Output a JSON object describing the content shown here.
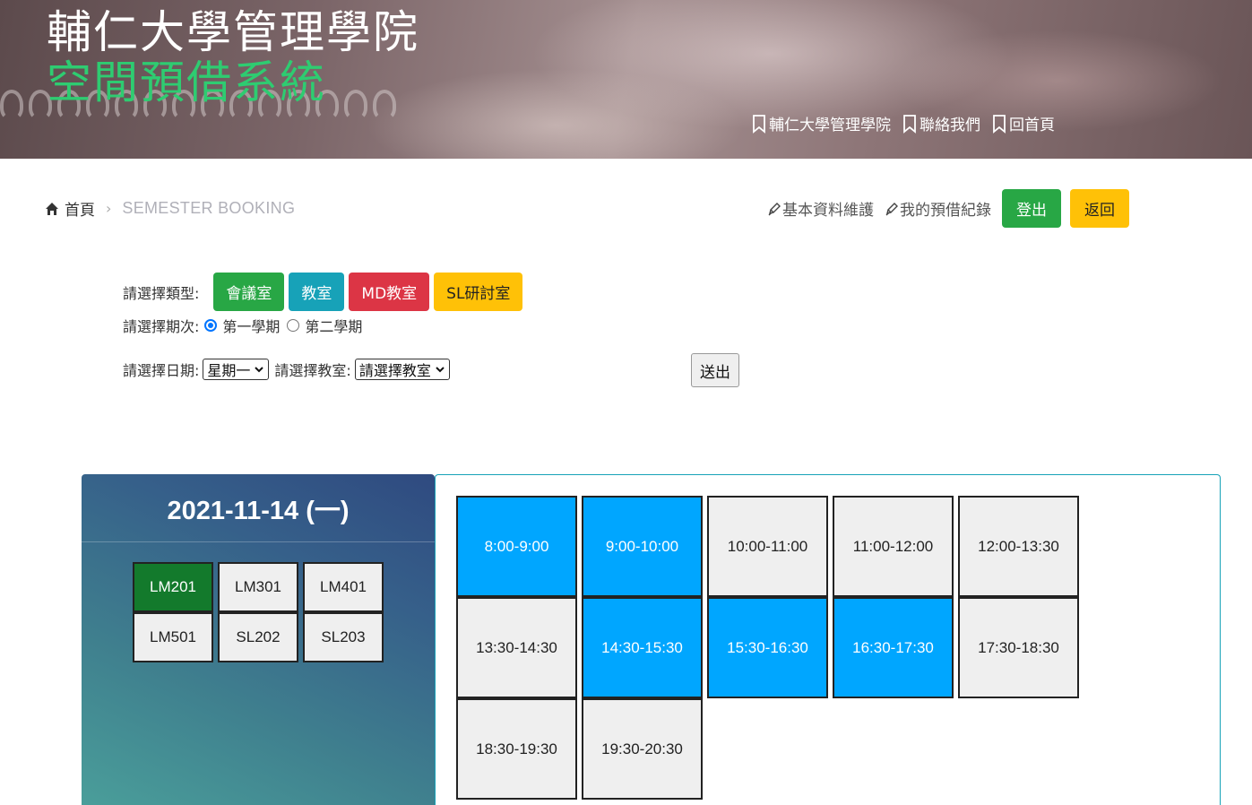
{
  "banner": {
    "title_line1": "輔仁大學管理學院",
    "title_line2": "空間預借系統",
    "links": [
      "輔仁大學管理學院",
      "聯絡我們",
      "回首頁"
    ]
  },
  "breadcrumb": {
    "home": "首頁",
    "separator": "›",
    "current": "SEMESTER BOOKING"
  },
  "top_actions": {
    "profile": "基本資料維護",
    "records": "我的預借紀錄",
    "logout": "登出",
    "back": "返回"
  },
  "form": {
    "type_label": "請選擇類型:",
    "types": [
      "會議室",
      "教室",
      "MD教室",
      "SL研討室"
    ],
    "semester_label": "請選擇期次:",
    "semesters": [
      {
        "label": "第一學期",
        "checked": true
      },
      {
        "label": "第二學期",
        "checked": false
      }
    ],
    "date_label": "請選擇日期:",
    "date_value": "星期一",
    "room_label": "請選擇教室:",
    "room_value": "請選擇教室",
    "submit": "送出"
  },
  "schedule": {
    "date": "2021-11-14 (一)",
    "rooms": [
      {
        "name": "LM201",
        "active": true
      },
      {
        "name": "LM301",
        "active": false
      },
      {
        "name": "LM401",
        "active": false
      },
      {
        "name": "LM501",
        "active": false
      },
      {
        "name": "SL202",
        "active": false
      },
      {
        "name": "SL203",
        "active": false
      }
    ],
    "slots": [
      {
        "time": "8:00-9:00",
        "booked": true
      },
      {
        "time": "9:00-10:00",
        "booked": true
      },
      {
        "time": "10:00-11:00",
        "booked": false
      },
      {
        "time": "11:00-12:00",
        "booked": false
      },
      {
        "time": "12:00-13:30",
        "booked": false
      },
      {
        "time": "13:30-14:30",
        "booked": false
      },
      {
        "time": "14:30-15:30",
        "booked": true
      },
      {
        "time": "15:30-16:30",
        "booked": true
      },
      {
        "time": "16:30-17:30",
        "booked": true
      },
      {
        "time": "17:30-18:30",
        "booked": false
      },
      {
        "time": "18:30-19:30",
        "booked": false
      },
      {
        "time": "19:30-20:30",
        "booked": false
      }
    ]
  },
  "colors": {
    "booked_slot": "#00a6ff",
    "active_room": "#137a2c",
    "banner_subtitle": "#2ecc71"
  }
}
